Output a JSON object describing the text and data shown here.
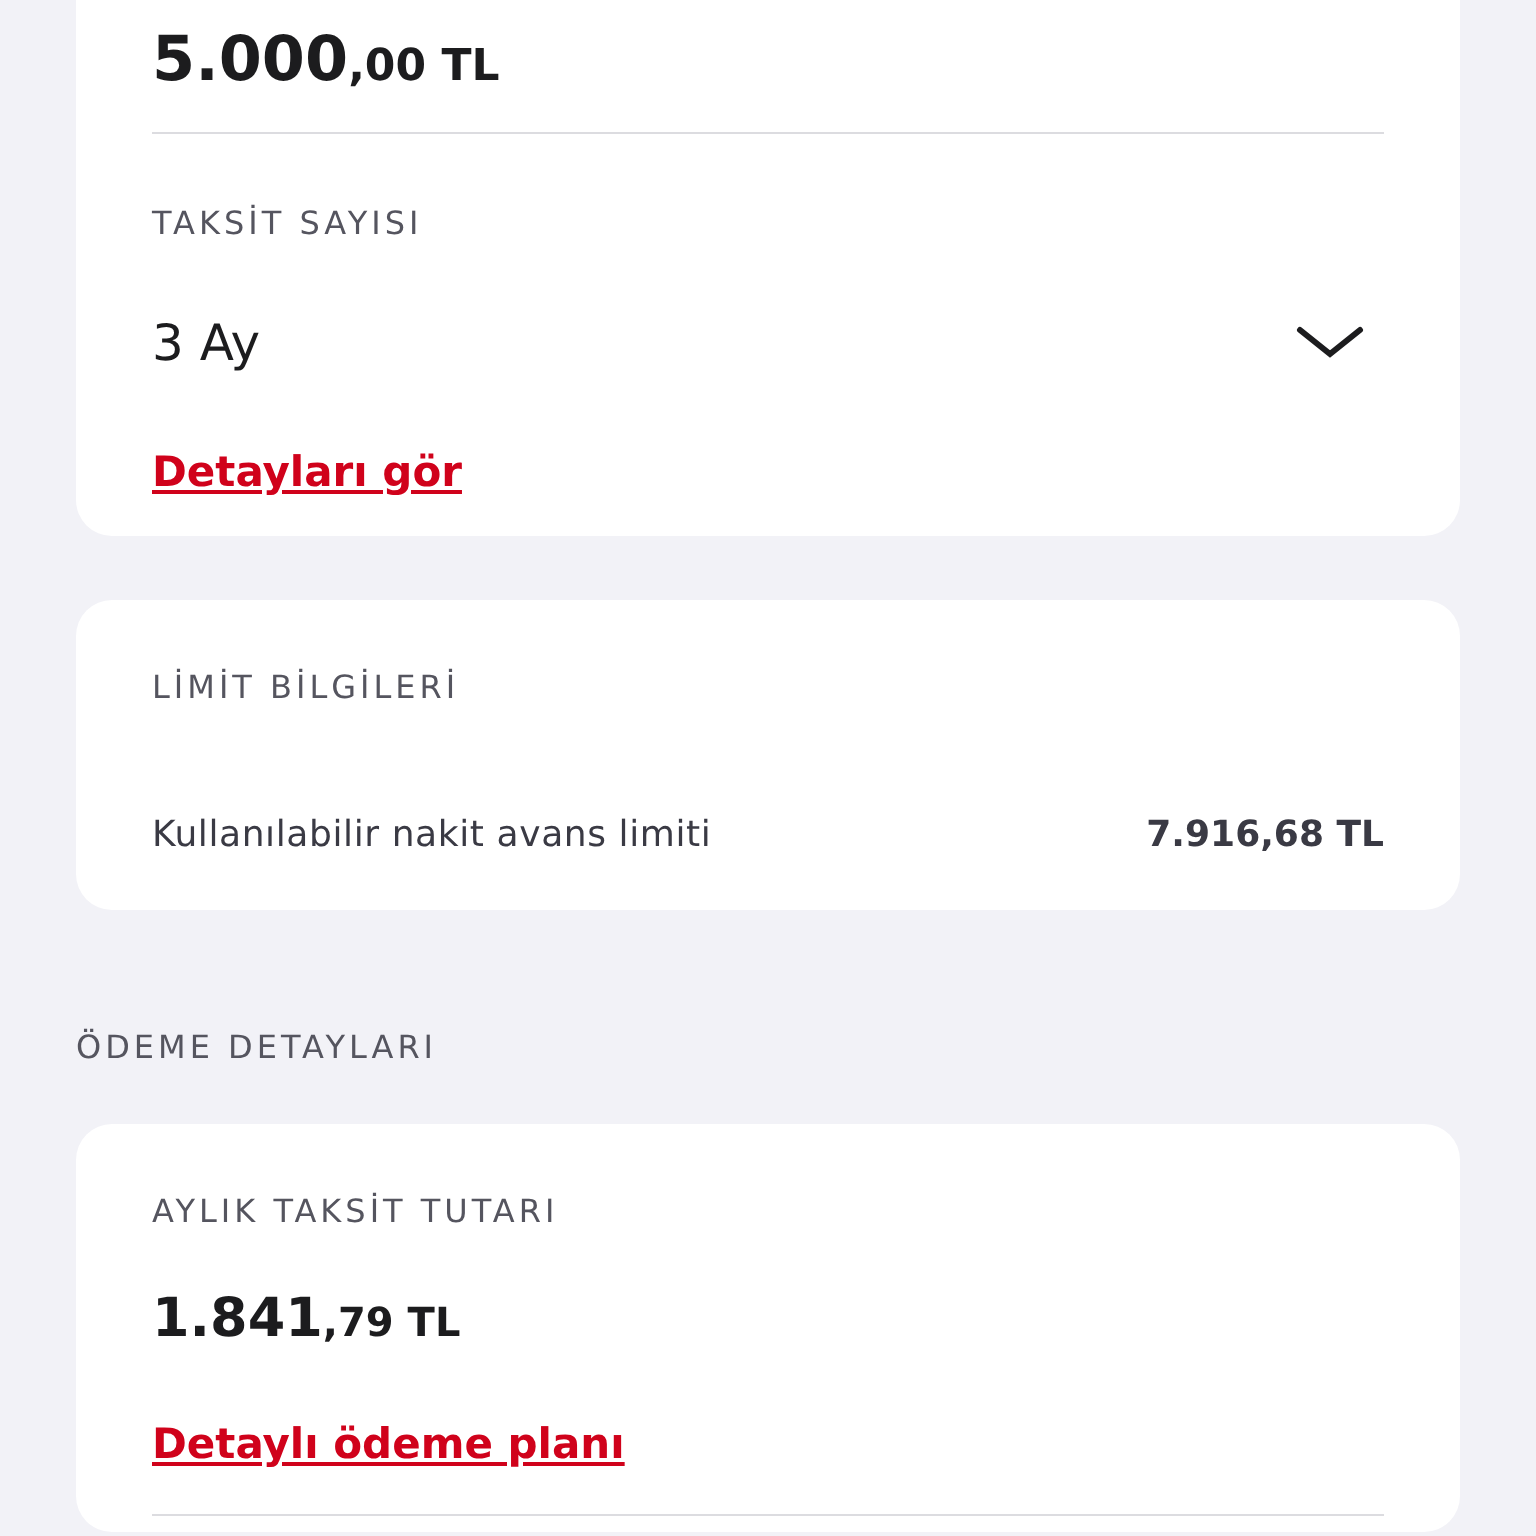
{
  "amount_card": {
    "amount_main": "5.000",
    "amount_fraction": ",00 TL",
    "installment_label": "TAKSİT SAYISI",
    "installment_value": "3 Ay",
    "details_link": "Detayları gör"
  },
  "limit_card": {
    "title": "LİMİT BİLGİLERİ",
    "rows": [
      {
        "label": "Kullanılabilir nakit avans limiti",
        "value": "7.916,68 TL"
      }
    ]
  },
  "payment_section": {
    "title": "ÖDEME DETAYLARI",
    "monthly_label": "AYLIK TAKSİT TUTARI",
    "amount_main": "1.841",
    "amount_fraction": ",79 TL",
    "plan_link": "Detaylı ödeme planı"
  }
}
